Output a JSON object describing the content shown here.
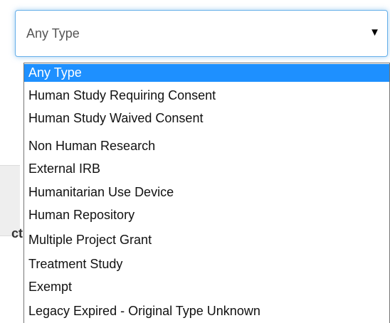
{
  "background": {
    "fragment_text": "ct"
  },
  "select": {
    "value": "Any Type",
    "arrow_icon": "triangle-down",
    "accent_color": "#66afe9"
  },
  "dropdown": {
    "selected_index": 0,
    "highlight_color": "#1e90ff",
    "options": [
      "Any Type",
      "Human Study Requiring Consent",
      "Human Study Waived Consent",
      "Non Human Research",
      "External IRB",
      "Humanitarian Use Device",
      "Human Repository",
      "Multiple Project Grant",
      "Treatment Study",
      "Exempt",
      "Legacy Expired - Original Type Unknown"
    ]
  }
}
